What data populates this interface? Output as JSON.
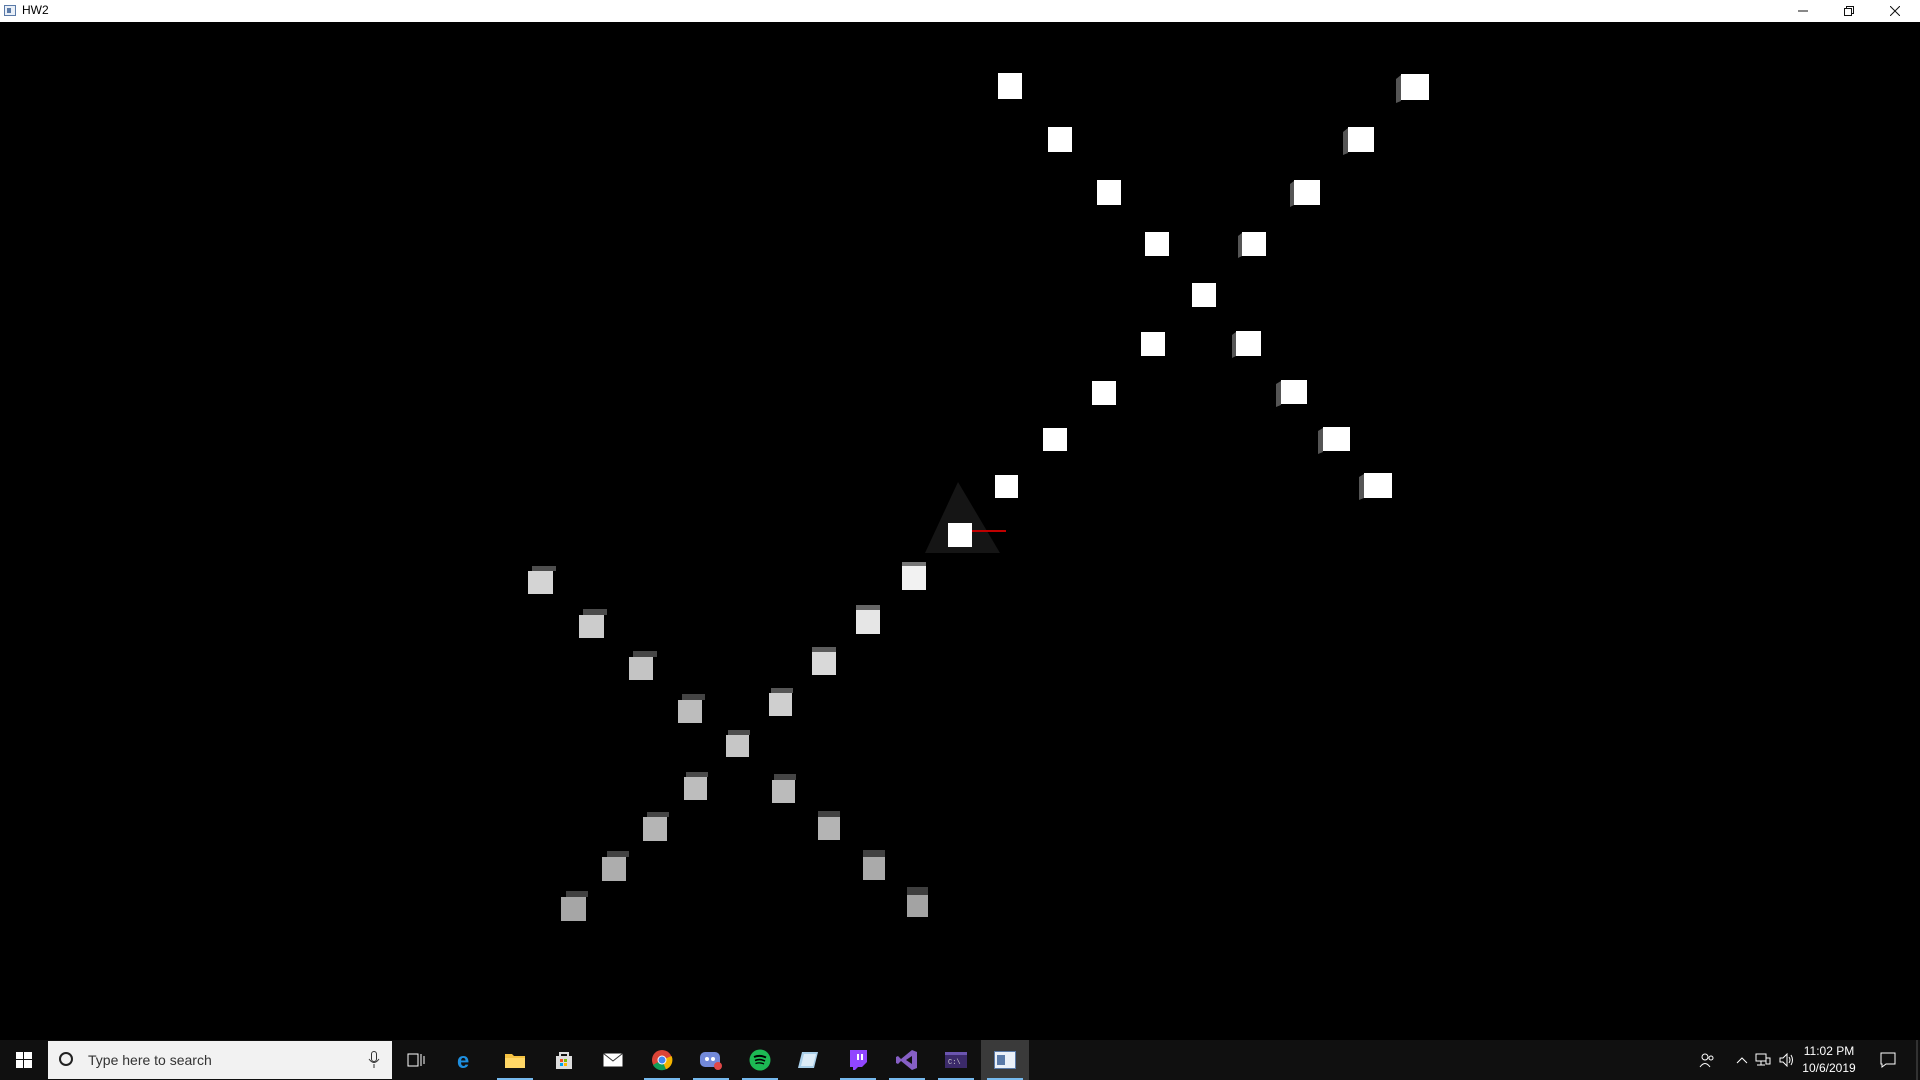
{
  "window": {
    "title": "HW2",
    "icon": "app-window-icon",
    "controls": [
      "minimize-icon",
      "restore-icon",
      "close-icon"
    ]
  },
  "scene": {
    "description_icon": "3d-scene-icon",
    "background": "#000000",
    "cube_color": "#ffffff",
    "cube_side_color": "#555555",
    "axis_color": "#c00000"
  },
  "taskbar": {
    "search_placeholder": "Type here to search",
    "apps": [
      {
        "name": "task-view-icon",
        "running": false
      },
      {
        "name": "edge-icon",
        "running": false
      },
      {
        "name": "file-explorer-icon",
        "running": true
      },
      {
        "name": "store-icon",
        "running": false
      },
      {
        "name": "mail-icon",
        "running": false
      },
      {
        "name": "chrome-icon",
        "running": true
      },
      {
        "name": "discord-icon",
        "running": true
      },
      {
        "name": "spotify-icon",
        "running": true
      },
      {
        "name": "sticky-app-icon",
        "running": false
      },
      {
        "name": "twitch-icon",
        "running": true
      },
      {
        "name": "visual-studio-icon",
        "running": true
      },
      {
        "name": "console-icon",
        "running": true
      },
      {
        "name": "hw2-app-icon",
        "running": true
      }
    ],
    "clock": {
      "time": "11:02 PM",
      "date": "10/6/2019"
    },
    "accent": "#76b9ed"
  }
}
